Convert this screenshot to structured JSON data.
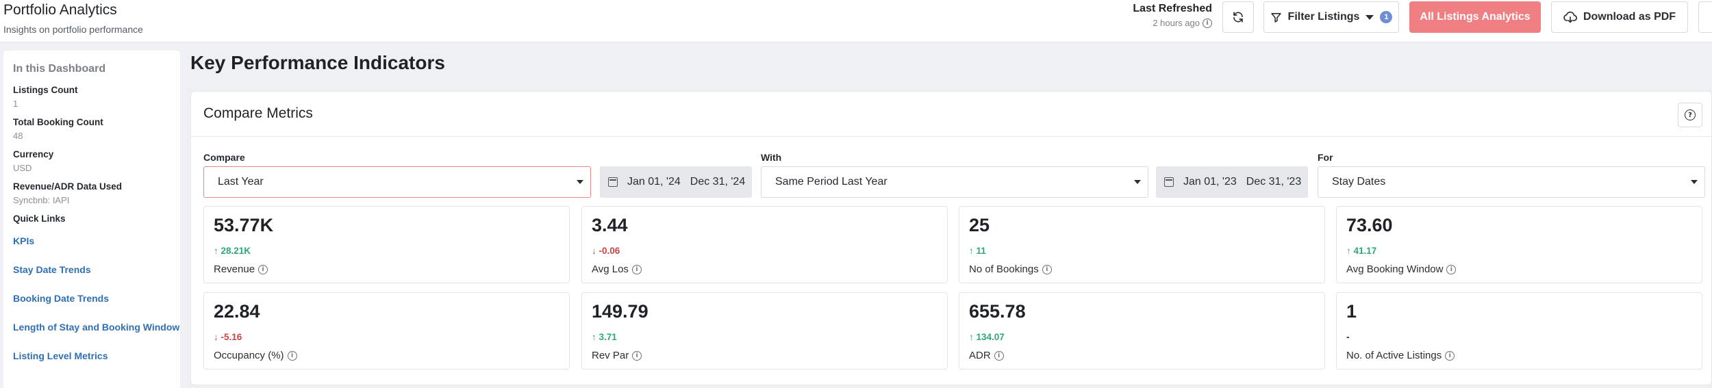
{
  "header": {
    "title": "Portfolio Analytics",
    "subtitle": "Insights on portfolio performance",
    "last_refreshed_label": "Last Refreshed",
    "last_refreshed_time": "2 hours ago",
    "filter_label": "Filter Listings",
    "filter_count": "1",
    "all_listings_label": "All Listings Analytics",
    "download_label": "Download as PDF"
  },
  "sidebar": {
    "heading": "In this Dashboard",
    "stats": [
      {
        "label": "Listings Count",
        "value": "1"
      },
      {
        "label": "Total Booking Count",
        "value": "48"
      },
      {
        "label": "Currency",
        "value": "USD"
      },
      {
        "label": "Revenue/ADR Data Used",
        "value": "Syncbnb: IAPI"
      }
    ],
    "quick_links_title": "Quick Links",
    "quick_links": [
      "KPIs",
      "Stay Date Trends",
      "Booking Date Trends",
      "Length of Stay and Booking Window",
      "Listing Level Metrics"
    ]
  },
  "main": {
    "title": "Key Performance Indicators",
    "card_title": "Compare Metrics",
    "compare": {
      "label": "Compare",
      "value": "Last Year",
      "date_start": "Jan 01, '24",
      "date_end": "Dec 31, '24"
    },
    "with": {
      "label": "With",
      "value": "Same Period Last Year",
      "date_start": "Jan 01, '23",
      "date_end": "Dec 31, '23"
    },
    "for": {
      "label": "For",
      "value": "Stay Dates"
    },
    "kpis": [
      {
        "value": "53.77K",
        "delta": "28.21K",
        "direction": "up",
        "label": "Revenue"
      },
      {
        "value": "3.44",
        "delta": "-0.06",
        "direction": "down",
        "label": "Avg Los"
      },
      {
        "value": "25",
        "delta": "11",
        "direction": "up",
        "label": "No of Bookings"
      },
      {
        "value": "73.60",
        "delta": "41.17",
        "direction": "up",
        "label": "Avg Booking Window"
      },
      {
        "value": "22.84",
        "delta": "-5.16",
        "direction": "down",
        "label": "Occupancy (%)"
      },
      {
        "value": "149.79",
        "delta": "3.71",
        "direction": "up",
        "label": "Rev Par"
      },
      {
        "value": "655.78",
        "delta": "134.07",
        "direction": "up",
        "label": "ADR"
      },
      {
        "value": "1",
        "delta": "-",
        "direction": "none",
        "label": "No. of Active Listings"
      }
    ]
  },
  "colors": {
    "accent": "#f07f83",
    "up": "#2fa876",
    "down": "#c94444",
    "link": "#2f6fb3",
    "badge": "#6e8fd6"
  }
}
